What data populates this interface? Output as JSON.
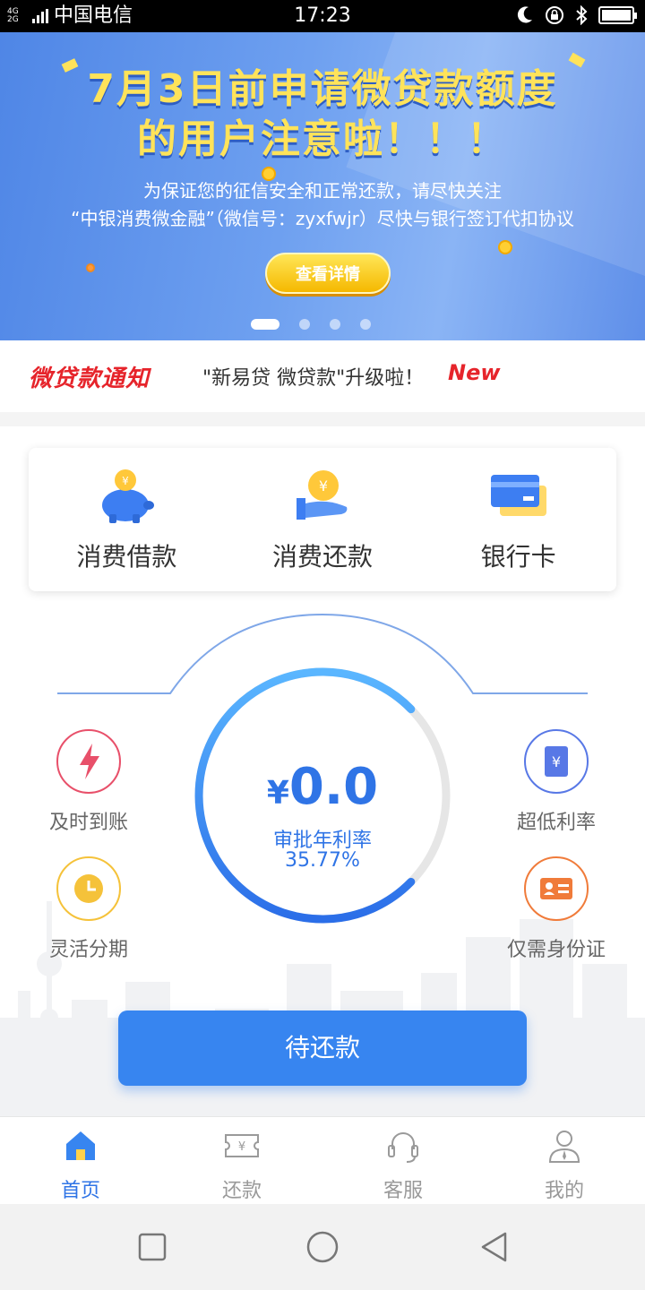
{
  "status_bar": {
    "network": "4G 2G",
    "carrier": "中国电信",
    "time": "17:23"
  },
  "banner": {
    "title_line1": "7月3日前申请微贷款额度",
    "title_line2": "的用户注意啦！！！",
    "sub_line1": "为保证您的征信安全和正常还款，请尽快关注",
    "sub_line2": "“中银消费微金融”（微信号：zyxfwjr）尽快与银行签订代扣协议",
    "button": "查看详情"
  },
  "notice": {
    "logo": "微贷款通知",
    "text": "\"新易贷 微贷款\"升级啦！",
    "badge": "New"
  },
  "quick_actions": [
    {
      "label": "消费借款",
      "icon": "piggy-bank-icon"
    },
    {
      "label": "消费还款",
      "icon": "hand-coin-icon"
    },
    {
      "label": "银行卡",
      "icon": "bank-card-icon"
    }
  ],
  "gauge": {
    "amount": "0.0",
    "currency": "¥",
    "label": "审批年利率",
    "rate": "35.77%"
  },
  "features": [
    {
      "label": "及时到账",
      "icon": "lightning-icon",
      "color": "#e8506a"
    },
    {
      "label": "灵活分期",
      "icon": "clock-icon",
      "color": "#f5c23a"
    },
    {
      "label": "超低利率",
      "icon": "yen-document-icon",
      "color": "#5878e6"
    },
    {
      "label": "仅需身份证",
      "icon": "id-card-icon",
      "color": "#f07b3a"
    }
  ],
  "primary_button": "待还款",
  "tabs": [
    {
      "label": "首页",
      "icon": "home-icon",
      "active": true
    },
    {
      "label": "还款",
      "icon": "ticket-yen-icon",
      "active": false
    },
    {
      "label": "客服",
      "icon": "headset-icon",
      "active": false
    },
    {
      "label": "我的",
      "icon": "person-icon",
      "active": false
    }
  ],
  "colors": {
    "accent": "#2f74e6",
    "button": "#3785f0",
    "notice_red": "#e6242b",
    "banner_yellow": "#ffe35a"
  }
}
